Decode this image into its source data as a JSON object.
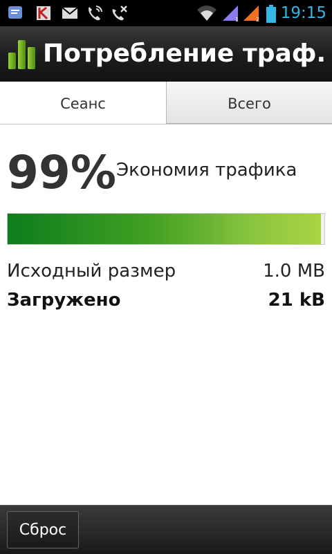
{
  "status_bar": {
    "time": "19:15",
    "icons": [
      "messages-icon",
      "kaspersky-icon",
      "email-icon",
      "call-icon",
      "missed-call-icon",
      "wifi-icon",
      "signal-sim1-icon",
      "signal-sim2-icon",
      "battery-icon"
    ],
    "time_color": "#33b5e5"
  },
  "action_bar": {
    "title": "Потребление траф...",
    "icon": "bar-chart-icon"
  },
  "tabs": [
    {
      "label": "Сеанс",
      "active": true
    },
    {
      "label": "Всего",
      "active": false
    }
  ],
  "savings": {
    "percent": "99%",
    "label": "Экономия трафика",
    "progress_fraction": 0.99
  },
  "stats": {
    "original_label": "Исходный размер",
    "original_value": "1.0 MB",
    "downloaded_label": "Загружено",
    "downloaded_value": "21 kB"
  },
  "bottom_bar": {
    "reset_label": "Сброс"
  },
  "colors": {
    "progress_start": "#0d7d1c",
    "progress_end": "#a8d442"
  }
}
